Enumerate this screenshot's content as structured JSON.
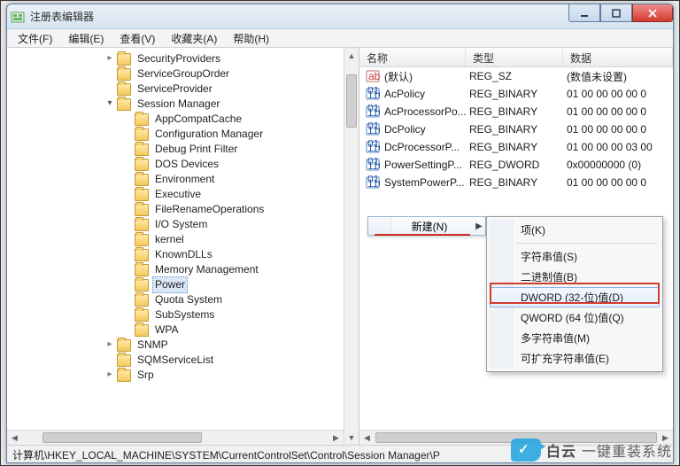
{
  "window": {
    "title": "注册表编辑器"
  },
  "menu": {
    "file": "文件(F)",
    "edit": "编辑(E)",
    "view": "查看(V)",
    "favorites": "收藏夹(A)",
    "help": "帮助(H)"
  },
  "tree": {
    "items": [
      {
        "indent": 5,
        "twisty": "closed",
        "label": "SecurityProviders"
      },
      {
        "indent": 5,
        "twisty": "none",
        "label": "ServiceGroupOrder"
      },
      {
        "indent": 5,
        "twisty": "none",
        "label": "ServiceProvider"
      },
      {
        "indent": 5,
        "twisty": "open",
        "label": "Session Manager"
      },
      {
        "indent": 6,
        "twisty": "none",
        "label": "AppCompatCache"
      },
      {
        "indent": 6,
        "twisty": "none",
        "label": "Configuration Manager"
      },
      {
        "indent": 6,
        "twisty": "none",
        "label": "Debug Print Filter"
      },
      {
        "indent": 6,
        "twisty": "none",
        "label": "DOS Devices"
      },
      {
        "indent": 6,
        "twisty": "none",
        "label": "Environment"
      },
      {
        "indent": 6,
        "twisty": "none",
        "label": "Executive"
      },
      {
        "indent": 6,
        "twisty": "none",
        "label": "FileRenameOperations"
      },
      {
        "indent": 6,
        "twisty": "none",
        "label": "I/O System"
      },
      {
        "indent": 6,
        "twisty": "none",
        "label": "kernel"
      },
      {
        "indent": 6,
        "twisty": "none",
        "label": "KnownDLLs"
      },
      {
        "indent": 6,
        "twisty": "none",
        "label": "Memory Management"
      },
      {
        "indent": 6,
        "twisty": "none",
        "label": "Power",
        "selected": true
      },
      {
        "indent": 6,
        "twisty": "none",
        "label": "Quota System"
      },
      {
        "indent": 6,
        "twisty": "none",
        "label": "SubSystems"
      },
      {
        "indent": 6,
        "twisty": "none",
        "label": "WPA"
      },
      {
        "indent": 5,
        "twisty": "closed",
        "label": "SNMP"
      },
      {
        "indent": 5,
        "twisty": "none",
        "label": "SQMServiceList"
      },
      {
        "indent": 5,
        "twisty": "closed",
        "label": "Srp"
      }
    ]
  },
  "columns": {
    "name": "名称",
    "type": "类型",
    "data": "数据"
  },
  "values": [
    {
      "icon": "str",
      "name": "(默认)",
      "type": "REG_SZ",
      "data": "(数值未设置)"
    },
    {
      "icon": "bin",
      "name": "AcPolicy",
      "type": "REG_BINARY",
      "data": "01 00 00 00 00 0"
    },
    {
      "icon": "bin",
      "name": "AcProcessorPo...",
      "type": "REG_BINARY",
      "data": "01 00 00 00 00 0"
    },
    {
      "icon": "bin",
      "name": "DcPolicy",
      "type": "REG_BINARY",
      "data": "01 00 00 00 00 0"
    },
    {
      "icon": "bin",
      "name": "DcProcessorP...",
      "type": "REG_BINARY",
      "data": "01 00 00 00 03 00"
    },
    {
      "icon": "bin",
      "name": "PowerSettingP...",
      "type": "REG_DWORD",
      "data": "0x00000000 (0)"
    },
    {
      "icon": "bin",
      "name": "SystemPowerP...",
      "type": "REG_BINARY",
      "data": "01 00 00 00 00 0"
    }
  ],
  "context": {
    "parent_label": "新建(N)",
    "items": [
      {
        "label": "项(K)"
      },
      {
        "sep": true
      },
      {
        "label": "字符串值(S)"
      },
      {
        "label": "二进制值(B)"
      },
      {
        "label": "DWORD (32-位)值(D)",
        "hot": true
      },
      {
        "label": "QWORD (64 位)值(Q)"
      },
      {
        "label": "多字符串值(M)"
      },
      {
        "label": "可扩充字符串值(E)"
      }
    ]
  },
  "statusbar": "计算机\\HKEY_LOCAL_MACHINE\\SYSTEM\\CurrentControlSet\\Control\\Session Manager\\P",
  "watermark": {
    "brand": "白云",
    "slogan": "一键重装系统"
  }
}
